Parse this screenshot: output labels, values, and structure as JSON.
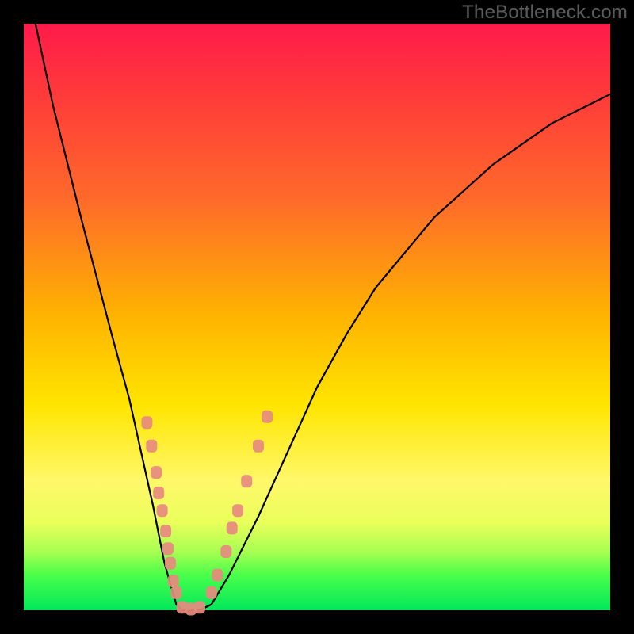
{
  "watermark": "TheBottleneck.com",
  "chart_data": {
    "type": "line",
    "title": "",
    "xlabel": "",
    "ylabel": "",
    "xlim": [
      0,
      100
    ],
    "ylim": [
      0,
      100
    ],
    "background_gradient": {
      "top_color": "#ff1a4b",
      "mid_color": "#ffe500",
      "bottom_color": "#00e85a",
      "meaning": "red=bad, green=good (bottleneck severity scale)"
    },
    "series": [
      {
        "name": "bottleneck-curve",
        "color": "#000000",
        "x": [
          2,
          5,
          10,
          15,
          18,
          20,
          22,
          24,
          26,
          27,
          30,
          32,
          35,
          40,
          45,
          50,
          55,
          60,
          70,
          80,
          90,
          100
        ],
        "values": [
          100,
          86,
          66,
          47,
          36,
          27,
          18,
          8,
          1,
          0,
          0,
          1,
          6,
          16,
          27,
          38,
          47,
          55,
          67,
          76,
          83,
          88
        ]
      }
    ],
    "markers": [
      {
        "name": "datapoints-left-branch",
        "shape": "rounded-rect",
        "color": "#e78a7f",
        "points": [
          {
            "x": 21.0,
            "y": 32.0
          },
          {
            "x": 21.8,
            "y": 28.0
          },
          {
            "x": 22.6,
            "y": 23.5
          },
          {
            "x": 23.0,
            "y": 20.0
          },
          {
            "x": 23.6,
            "y": 17.0
          },
          {
            "x": 24.2,
            "y": 13.5
          },
          {
            "x": 24.6,
            "y": 10.5
          },
          {
            "x": 25.0,
            "y": 8.0
          },
          {
            "x": 25.5,
            "y": 5.0
          },
          {
            "x": 26.0,
            "y": 3.0
          }
        ]
      },
      {
        "name": "datapoints-bottom",
        "shape": "rounded-rect",
        "color": "#e78a7f",
        "points": [
          {
            "x": 27.0,
            "y": 0.5
          },
          {
            "x": 28.5,
            "y": 0.2
          },
          {
            "x": 30.0,
            "y": 0.5
          }
        ]
      },
      {
        "name": "datapoints-right-branch",
        "shape": "rounded-rect",
        "color": "#e78a7f",
        "points": [
          {
            "x": 32.0,
            "y": 3.0
          },
          {
            "x": 33.0,
            "y": 6.0
          },
          {
            "x": 34.5,
            "y": 10.0
          },
          {
            "x": 35.5,
            "y": 14.0
          },
          {
            "x": 36.5,
            "y": 17.0
          },
          {
            "x": 38.0,
            "y": 22.0
          },
          {
            "x": 40.0,
            "y": 28.0
          },
          {
            "x": 41.5,
            "y": 33.0
          }
        ]
      }
    ]
  }
}
